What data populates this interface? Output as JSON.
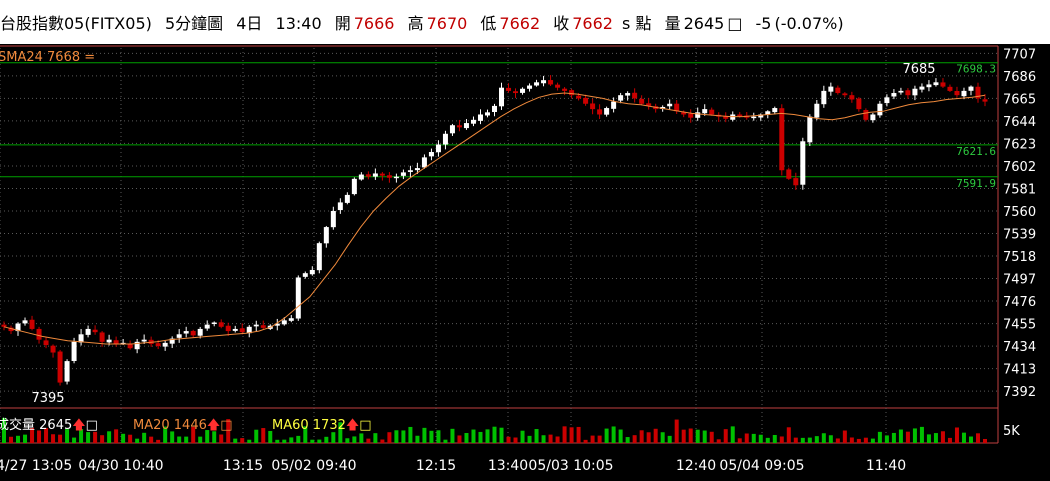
{
  "header": {
    "title": "台股指數05(FITX05)",
    "interval": "5分鐘圖",
    "date": "4日",
    "time": "13:40",
    "open_label": "開",
    "open": "7666",
    "high_label": "高",
    "high": "7670",
    "low_label": "低",
    "low": "7662",
    "close_label": "收",
    "close": "7662",
    "unit": "s 點",
    "volume_label": "量",
    "volume": "2645",
    "volume_box": "□",
    "change": "-5",
    "change_pct": "(-0.07%)"
  },
  "indicators": {
    "sma_label": "SMA24 7668",
    "sma_box": "=",
    "vol_label": "成交量",
    "vol_value": "2645",
    "ma20_label": "MA20 1446",
    "ma60_label": "MA60 1732",
    "box": "□",
    "arrow": "🡅"
  },
  "colors": {
    "background": "#000000",
    "up": "#ffffff",
    "down": "#cc0000",
    "sma": "#f08a3c",
    "grid": "#5a5a5a",
    "ref_line": "#00a000",
    "ref_label": "#2ecc40",
    "axis_border": "#c04040"
  },
  "chart_data": {
    "type": "candlestick",
    "title": "",
    "xlabel": "",
    "ylabel": "",
    "ylim": [
      7380,
      7712
    ],
    "grid": true,
    "y_ticks": [
      7707,
      7686,
      7665,
      7644,
      7623,
      7602,
      7581,
      7560,
      7539,
      7518,
      7497,
      7476,
      7455,
      7434,
      7413,
      7392
    ],
    "x_tick_labels": [
      "4/27 13:05",
      "04/30 10:40",
      "13:15",
      "05/02 09:40",
      "12:15",
      "13:40",
      "05/03 10:05",
      "12:40",
      "05/04 09:05",
      "11:40"
    ],
    "reference_lines": [
      {
        "value": 7698.3,
        "label": "7698.3"
      },
      {
        "value": 7621.6,
        "label": "7621.6"
      },
      {
        "value": 7591.9,
        "label": "7591.9"
      }
    ],
    "annotations": [
      {
        "text": "7395",
        "value": 7395
      },
      {
        "text": "7685",
        "value": 7685
      }
    ],
    "close_series": [
      7452,
      7448,
      7455,
      7458,
      7450,
      7440,
      7435,
      7428,
      7400,
      7420,
      7438,
      7445,
      7450,
      7447,
      7438,
      7440,
      7436,
      7437,
      7432,
      7438,
      7440,
      7436,
      7434,
      7437,
      7441,
      7445,
      7448,
      7444,
      7450,
      7454,
      7456,
      7452,
      7448,
      7450,
      7447,
      7452,
      7454,
      7451,
      7453,
      7455,
      7458,
      7460,
      7498,
      7502,
      7505,
      7530,
      7545,
      7560,
      7568,
      7575,
      7590,
      7594,
      7592,
      7595,
      7593,
      7591,
      7592,
      7596,
      7598,
      7600,
      7610,
      7615,
      7622,
      7632,
      7640,
      7638,
      7642,
      7645,
      7650,
      7652,
      7658,
      7675,
      7672,
      7670,
      7674,
      7677,
      7680,
      7682,
      7678,
      7675,
      7672,
      7668,
      7665,
      7660,
      7655,
      7650,
      7656,
      7662,
      7668,
      7670,
      7665,
      7660,
      7658,
      7655,
      7657,
      7660,
      7653,
      7650,
      7647,
      7652,
      7655,
      7650,
      7648,
      7646,
      7650,
      7649,
      7647,
      7648,
      7650,
      7653,
      7656,
      7598,
      7590,
      7584,
      7625,
      7648,
      7660,
      7672,
      7676,
      7670,
      7668,
      7664,
      7655,
      7645,
      7650,
      7660,
      7666,
      7670,
      7672,
      7668,
      7674,
      7676,
      7678,
      7680,
      7676,
      7672,
      7668,
      7672,
      7676,
      7665,
      7662
    ],
    "sma24_series": [
      7452,
      7449,
      7446,
      7443,
      7441,
      7439,
      7438,
      7437,
      7436,
      7436,
      7436,
      7437,
      7438,
      7440,
      7441,
      7442,
      7443,
      7444,
      7445,
      7446,
      7448,
      7452,
      7460,
      7470,
      7480,
      7495,
      7510,
      7528,
      7545,
      7560,
      7572,
      7583,
      7592,
      7600,
      7608,
      7616,
      7624,
      7632,
      7640,
      7648,
      7655,
      7661,
      7666,
      7669,
      7670,
      7669,
      7667,
      7665,
      7662,
      7660,
      7659,
      7657,
      7655,
      7653,
      7651,
      7650,
      7649,
      7648,
      7648,
      7649,
      7650,
      7651,
      7650,
      7648,
      7646,
      7645,
      7647,
      7650,
      7652,
      7653,
      7656,
      7659,
      7661,
      7662,
      7664,
      7665,
      7666,
      7668
    ],
    "volume": {
      "ylim": [
        0,
        5000
      ],
      "y_tick_labels": [
        "5K"
      ]
    }
  }
}
